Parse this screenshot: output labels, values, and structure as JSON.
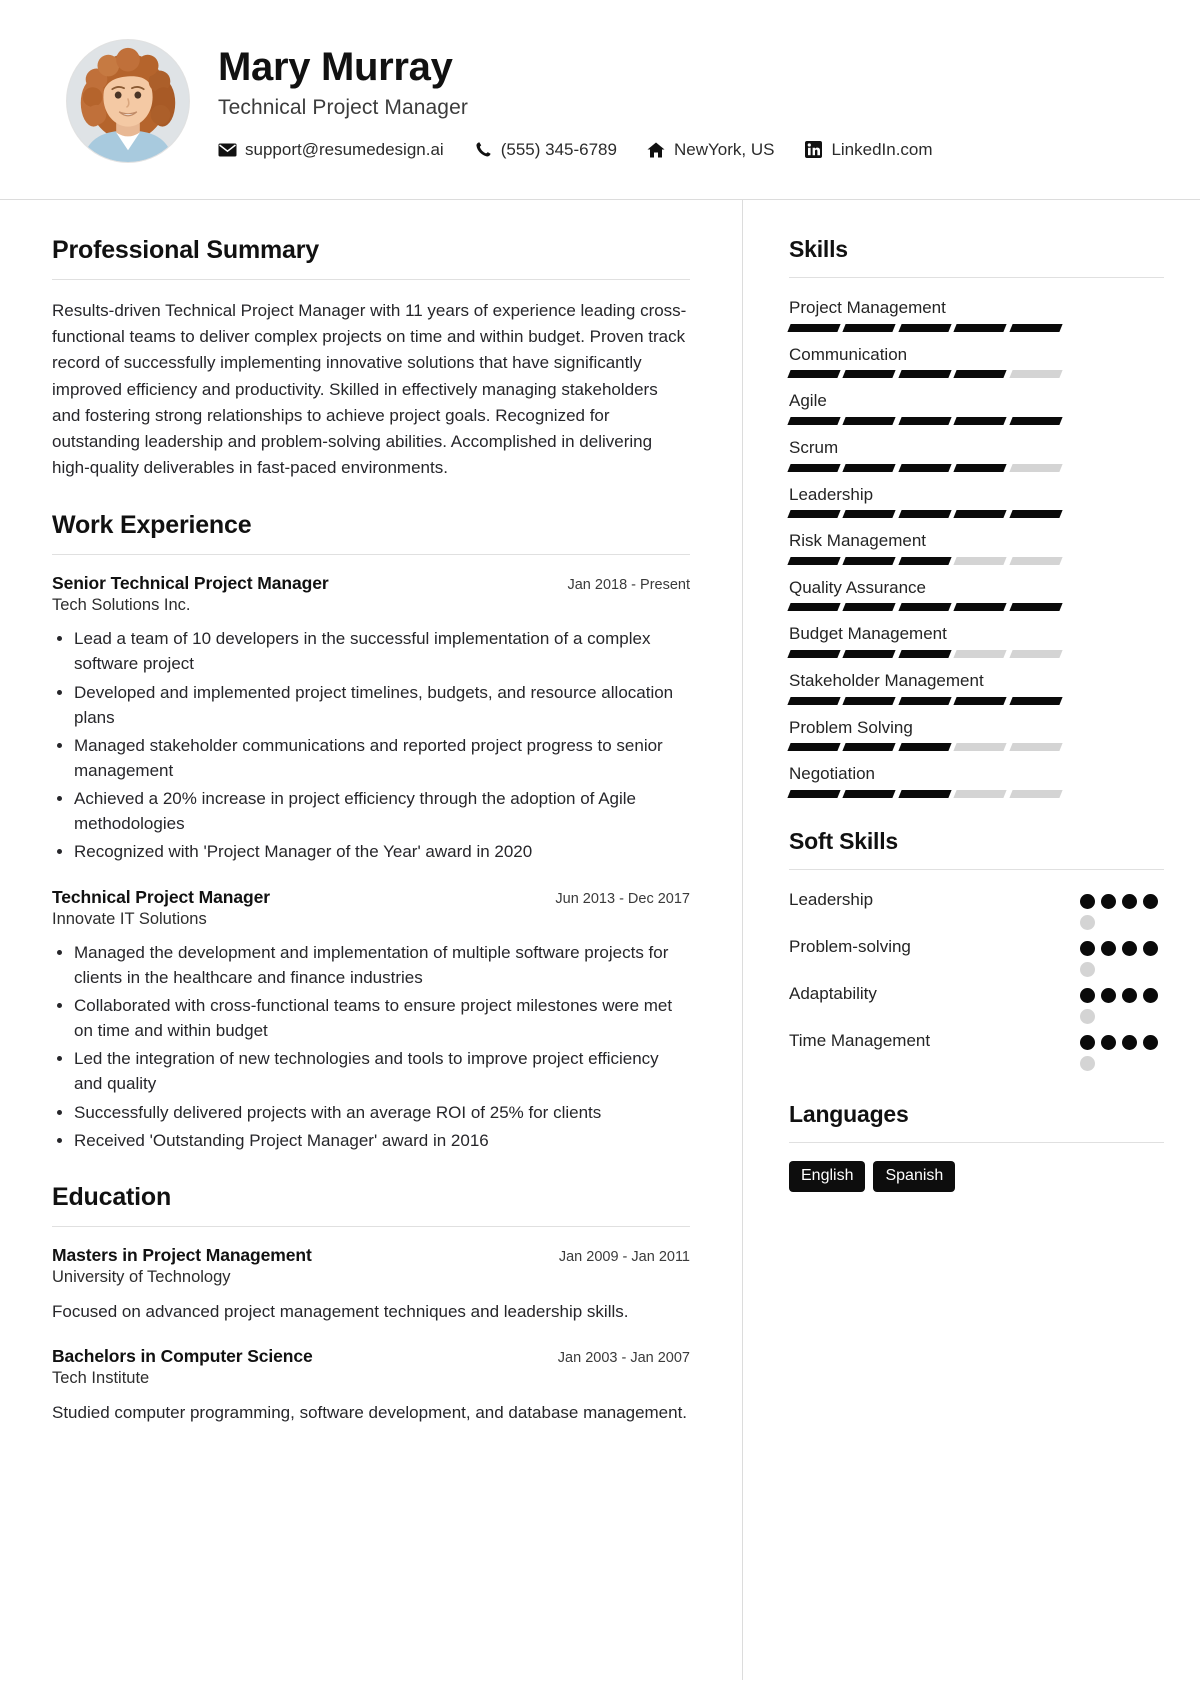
{
  "header": {
    "name": "Mary Murray",
    "job_title": "Technical Project Manager",
    "avatar_name": "profile-photo",
    "contacts": [
      {
        "icon": "email-icon",
        "text": "support@resumedesign.ai"
      },
      {
        "icon": "phone-icon",
        "text": "(555) 345-6789"
      },
      {
        "icon": "home-icon",
        "text": "NewYork, US"
      },
      {
        "icon": "linkedin-icon",
        "text": "LinkedIn.com"
      }
    ]
  },
  "main": {
    "summary": {
      "title": "Professional Summary",
      "text": "Results-driven Technical Project Manager with 11 years of experience leading cross-functional teams to deliver complex projects on time and within budget. Proven track record of successfully implementing innovative solutions that have significantly improved efficiency and productivity. Skilled in effectively managing stakeholders and fostering strong relationships to achieve project goals. Recognized for outstanding leadership and problem-solving abilities. Accomplished in delivering high-quality deliverables in fast-paced environments."
    },
    "experience": {
      "title": "Work Experience",
      "entries": [
        {
          "role": "Senior Technical Project Manager",
          "date": "Jan 2018 - Present",
          "org": "Tech Solutions Inc.",
          "bullets": [
            "Lead a team of 10 developers in the successful implementation of a complex software project",
            "Developed and implemented project timelines, budgets, and resource allocation plans",
            "Managed stakeholder communications and reported project progress to senior management",
            "Achieved a 20% increase in project efficiency through the adoption of Agile methodologies",
            "Recognized with 'Project Manager of the Year' award in 2020"
          ]
        },
        {
          "role": "Technical Project Manager",
          "date": "Jun 2013 - Dec 2017",
          "org": "Innovate IT Solutions",
          "bullets": [
            "Managed the development and implementation of multiple software projects for clients in the healthcare and finance industries",
            "Collaborated with cross-functional teams to ensure project milestones were met on time and within budget",
            "Led the integration of new technologies and tools to improve project efficiency and quality",
            "Successfully delivered projects with an average ROI of 25% for clients",
            "Received 'Outstanding Project Manager' award in 2016"
          ]
        }
      ]
    },
    "education": {
      "title": "Education",
      "entries": [
        {
          "role": "Masters in Project Management",
          "date": "Jan 2009 - Jan 2011",
          "org": "University of Technology",
          "desc": "Focused on advanced project management techniques and leadership skills."
        },
        {
          "role": "Bachelors in Computer Science",
          "date": "Jan 2003 - Jan 2007",
          "org": "Tech Institute",
          "desc": "Studied computer programming, software development, and database management."
        }
      ]
    }
  },
  "sidebar": {
    "skills": {
      "title": "Skills",
      "max": 5,
      "items": [
        {
          "name": "Project Management",
          "level": 5
        },
        {
          "name": "Communication",
          "level": 4
        },
        {
          "name": "Agile",
          "level": 5
        },
        {
          "name": "Scrum",
          "level": 4
        },
        {
          "name": "Leadership",
          "level": 5
        },
        {
          "name": "Risk Management",
          "level": 3
        },
        {
          "name": "Quality Assurance",
          "level": 5
        },
        {
          "name": "Budget Management",
          "level": 3
        },
        {
          "name": "Stakeholder Management",
          "level": 5
        },
        {
          "name": "Problem Solving",
          "level": 3
        },
        {
          "name": "Negotiation",
          "level": 3
        }
      ]
    },
    "soft_skills": {
      "title": "Soft Skills",
      "max": 5,
      "items": [
        {
          "name": "Leadership",
          "level": 4
        },
        {
          "name": "Problem-solving",
          "level": 4
        },
        {
          "name": "Adaptability",
          "level": 4
        },
        {
          "name": "Time Management",
          "level": 4
        }
      ]
    },
    "languages": {
      "title": "Languages",
      "items": [
        "English",
        "Spanish"
      ]
    }
  },
  "colors": {
    "accent": "#0a0a0a",
    "muted": "#d4d4d4",
    "rule": "#e0e0e0",
    "text": "#26262a"
  }
}
